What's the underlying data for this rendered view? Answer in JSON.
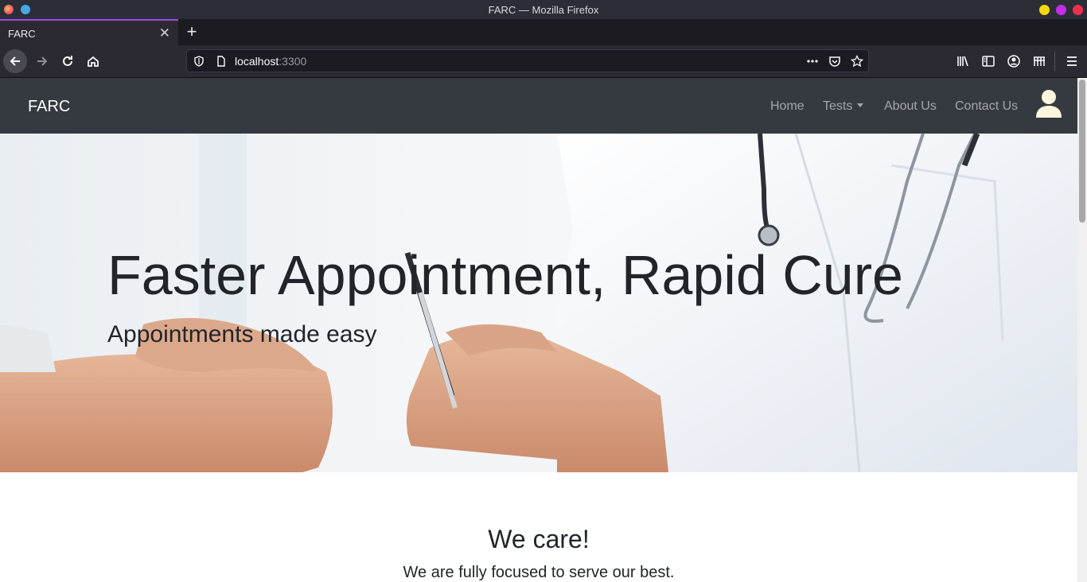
{
  "window": {
    "title": "FARC — Mozilla Firefox"
  },
  "tabs": [
    {
      "label": "FARC"
    }
  ],
  "url": {
    "host": "localhost",
    "port": ":3300"
  },
  "site_nav": {
    "brand": "FARC",
    "links": {
      "home": "Home",
      "tests": "Tests",
      "about": "About Us",
      "contact": "Contact Us"
    }
  },
  "hero": {
    "title": "Faster Appointment, Rapid Cure",
    "subtitle": "Appointments made easy"
  },
  "section": {
    "title": "We care!",
    "text": "We are fully focused to serve our best."
  },
  "colors": {
    "navbar": "#343a40",
    "accent_tab": "#a347e0",
    "user_icon": "#fdf6dc"
  },
  "icons": [
    "back-icon",
    "forward-icon",
    "reload-icon",
    "home-icon",
    "shield-icon",
    "page-icon",
    "more-icon",
    "pocket-icon",
    "star-icon",
    "library-icon",
    "sidebar-icon",
    "account-icon",
    "extensions-icon",
    "menu-icon",
    "close-icon",
    "plus-icon",
    "user-icon"
  ]
}
